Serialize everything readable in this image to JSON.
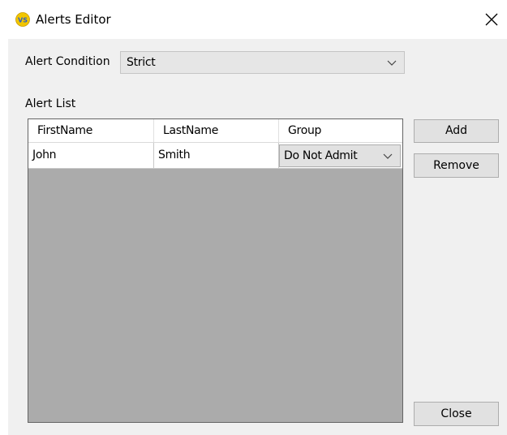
{
  "window": {
    "title": "Alerts Editor",
    "icon": "vs-app-icon",
    "close_icon": "close-icon"
  },
  "condition": {
    "label": "Alert Condition",
    "value": "Strict"
  },
  "alert_list": {
    "label": "Alert List",
    "columns": [
      "FirstName",
      "LastName",
      "Group"
    ],
    "rows": [
      {
        "first_name": "John",
        "last_name": "Smith",
        "group": "Do Not Admit"
      }
    ]
  },
  "buttons": {
    "add": "Add",
    "remove": "Remove",
    "close": "Close"
  },
  "colors": {
    "client_bg": "#f0f0f0",
    "grid_empty_bg": "#ababab",
    "button_bg": "#e1e1e1",
    "icon_yellow": "#f2c600",
    "icon_blue": "#2f5fc4"
  }
}
